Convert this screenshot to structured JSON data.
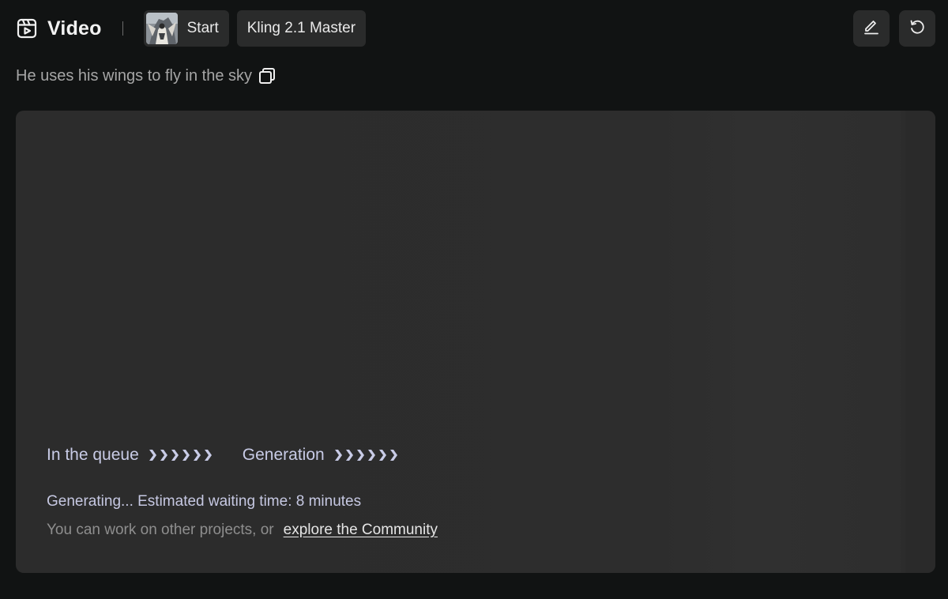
{
  "header": {
    "title": "Video",
    "start_chip_label": "Start",
    "model_chip_label": "Kling 2.1 Master",
    "icons": {
      "title": "video-icon",
      "edit": "pencil-icon",
      "regenerate": "undo-icon"
    }
  },
  "prompt": {
    "text": "He uses his wings to fly in the sky",
    "copy_icon": "copy-icon"
  },
  "progress": {
    "stages": [
      {
        "label": "In the queue",
        "icon": "chevrons-icon"
      },
      {
        "label": "Generation",
        "icon": "chevrons-icon"
      }
    ],
    "status_text": "Generating... Estimated waiting time: 8 minutes",
    "hint_text": "You can work on other projects, or",
    "community_link": "explore the Community"
  },
  "colors": {
    "background": "#111313",
    "card": "#2c2c2c",
    "chip": "#2a2b2b",
    "stage_text": "#c8cbe6"
  }
}
